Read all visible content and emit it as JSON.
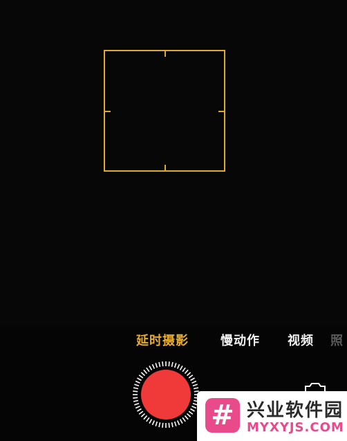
{
  "camera": {
    "modes": [
      {
        "label": "延时摄影",
        "state": "active"
      },
      {
        "label": "慢动作",
        "state": "normal"
      },
      {
        "label": "视频",
        "state": "normal"
      },
      {
        "label": "照",
        "state": "faded"
      }
    ],
    "focus_color": "#e0aa2a",
    "active_mode_color": "#e8ad2c",
    "shutter_color": "#f03a3a",
    "shutter_icon": "record-button",
    "flip_icon": "flip-camera-icon"
  },
  "watermark": {
    "logo_glyph": "#",
    "title": "兴业软件园",
    "url": "MYXYJS.COM",
    "accent_color": "#e84a8a"
  }
}
